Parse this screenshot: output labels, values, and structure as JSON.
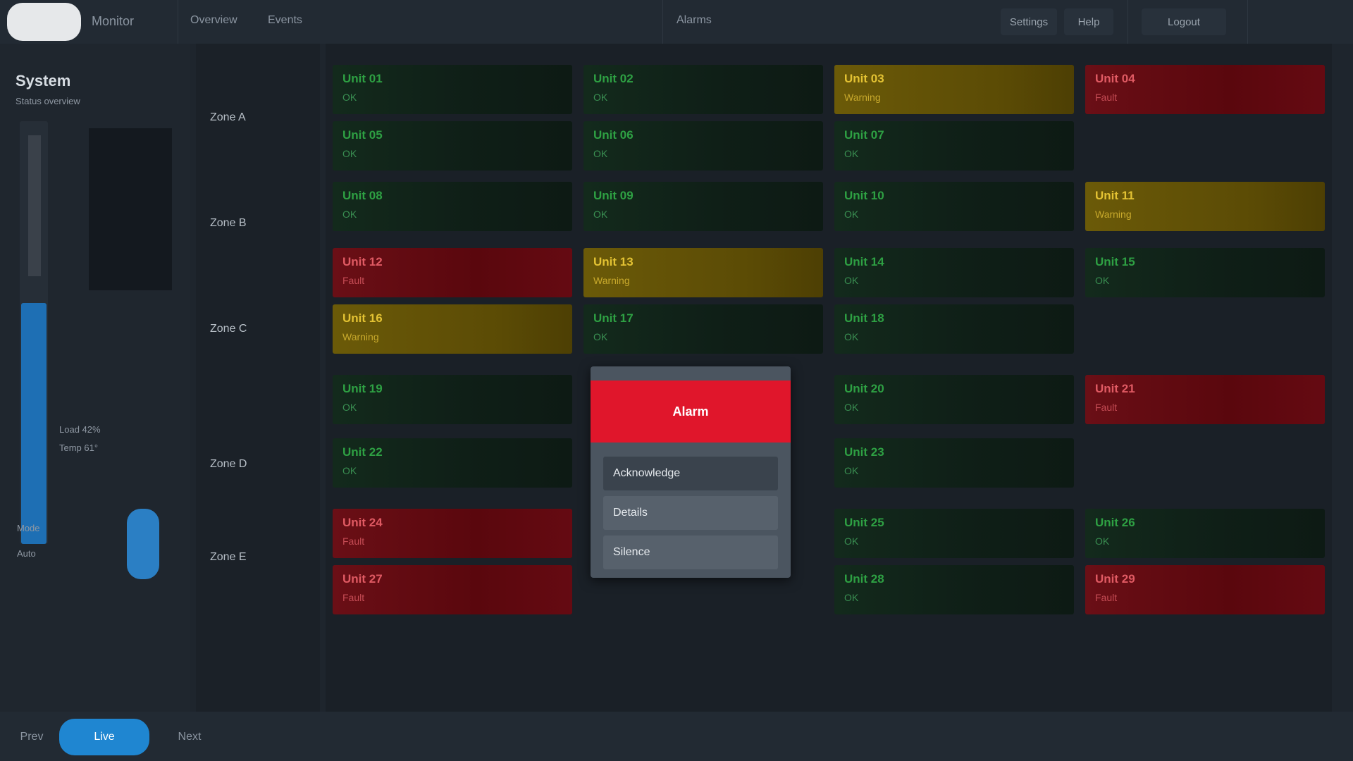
{
  "topbar": {
    "app_title": "Monitor",
    "items": [
      "Overview",
      "Events",
      "Alarms"
    ],
    "buttons": [
      "Settings",
      "Help",
      "Logout"
    ]
  },
  "left_panel": {
    "title": "System",
    "subtitle": "Status overview",
    "stats": [
      "Load 42%",
      "Temp 61°"
    ],
    "small_labels": [
      "Mode",
      "Auto"
    ],
    "meter_level_percent": 57
  },
  "row_labels": [
    "Zone A",
    "Zone B",
    "Zone C",
    "Zone D",
    "Zone E"
  ],
  "grid": {
    "cells": [
      {
        "id": "c1",
        "status": "ok",
        "name": "Unit 01",
        "value": "OK"
      },
      {
        "id": "c2",
        "status": "ok",
        "name": "Unit 02",
        "value": "OK"
      },
      {
        "id": "c3",
        "status": "warn",
        "name": "Unit 03",
        "value": "Warning"
      },
      {
        "id": "c4",
        "status": "err",
        "name": "Unit 04",
        "value": "Fault"
      },
      {
        "id": "c5",
        "status": "ok",
        "name": "Unit 05",
        "value": "OK"
      },
      {
        "id": "c6",
        "status": "ok",
        "name": "Unit 06",
        "value": "OK"
      },
      {
        "id": "c7",
        "status": "ok",
        "name": "Unit 07",
        "value": "OK"
      },
      {
        "id": "c8",
        "status": "ok",
        "name": "Unit 08",
        "value": "OK"
      },
      {
        "id": "c9",
        "status": "ok",
        "name": "Unit 09",
        "value": "OK"
      },
      {
        "id": "c10",
        "status": "ok",
        "name": "Unit 10",
        "value": "OK"
      },
      {
        "id": "c11",
        "status": "warn",
        "name": "Unit 11",
        "value": "Warning"
      },
      {
        "id": "c12",
        "status": "err",
        "name": "Unit 12",
        "value": "Fault"
      },
      {
        "id": "c13",
        "status": "warn",
        "name": "Unit 13",
        "value": "Warning"
      },
      {
        "id": "c14",
        "status": "ok",
        "name": "Unit 14",
        "value": "OK"
      },
      {
        "id": "c15",
        "status": "ok",
        "name": "Unit 15",
        "value": "OK"
      },
      {
        "id": "c16",
        "status": "warn",
        "name": "Unit 16",
        "value": "Warning"
      },
      {
        "id": "c17",
        "status": "ok",
        "name": "Unit 17",
        "value": "OK"
      },
      {
        "id": "c18",
        "status": "ok",
        "name": "Unit 18",
        "value": "OK"
      },
      {
        "id": "c19",
        "status": "ok",
        "name": "Unit 19",
        "value": "OK"
      },
      {
        "id": "c20",
        "status": "ok",
        "name": "Unit 20",
        "value": "OK"
      },
      {
        "id": "c21",
        "status": "err",
        "name": "Unit 21",
        "value": "Fault"
      },
      {
        "id": "c22",
        "status": "ok",
        "name": "Unit 22",
        "value": "OK"
      },
      {
        "id": "c23",
        "status": "ok",
        "name": "Unit 23",
        "value": "OK"
      },
      {
        "id": "c24",
        "status": "err",
        "name": "Unit 24",
        "value": "Fault"
      },
      {
        "id": "c25",
        "status": "ok",
        "name": "Unit 25",
        "value": "OK"
      },
      {
        "id": "c26",
        "status": "ok",
        "name": "Unit 26",
        "value": "OK"
      },
      {
        "id": "c27",
        "status": "err",
        "name": "Unit 27",
        "value": "Fault"
      },
      {
        "id": "c28",
        "status": "ok",
        "name": "Unit 28",
        "value": "OK"
      },
      {
        "id": "c29",
        "status": "err",
        "name": "Unit 29",
        "value": "Fault"
      }
    ]
  },
  "popup": {
    "title": "Alarm",
    "items": [
      "Acknowledge",
      "Details",
      "Silence"
    ]
  },
  "footer": {
    "buttons": [
      "Prev",
      "Live",
      "Next"
    ]
  },
  "colors": {
    "accent": "#1f86d1",
    "ok": "#2ea043",
    "warn": "#e3c233",
    "error": "#e0162b"
  }
}
